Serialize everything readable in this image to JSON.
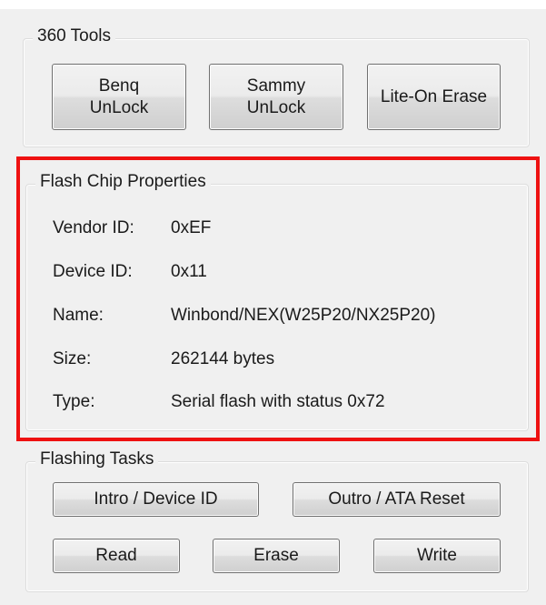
{
  "tools_group": {
    "title": "360 Tools",
    "buttons": {
      "benq": "Benq\nUnLock",
      "sammy": "Sammy\nUnLock",
      "liteon": "Lite-On Erase"
    }
  },
  "flash_chip": {
    "title": "Flash Chip Properties",
    "vendor_id": {
      "label": "Vendor ID:",
      "value": "0xEF"
    },
    "device_id": {
      "label": "Device ID:",
      "value": "0x11"
    },
    "name": {
      "label": "Name:",
      "value": "Winbond/NEX(W25P20/NX25P20)"
    },
    "size": {
      "label": "Size:",
      "value": "262144 bytes"
    },
    "type": {
      "label": "Type:",
      "value": "Serial flash with status 0x72"
    }
  },
  "flashing_tasks": {
    "title": "Flashing Tasks",
    "buttons": {
      "intro": "Intro / Device ID",
      "outro": "Outro / ATA Reset",
      "read": "Read",
      "erase": "Erase",
      "write": "Write"
    }
  },
  "colors": {
    "highlight_border": "#ee1111",
    "window_bg": "#f0f0f0",
    "button_border": "#707070"
  }
}
